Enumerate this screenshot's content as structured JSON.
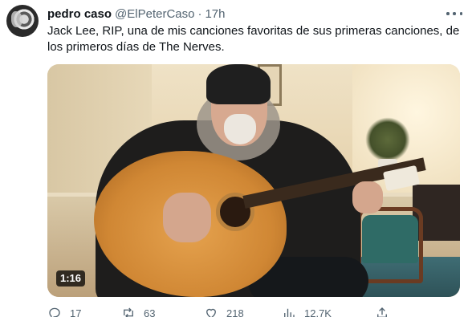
{
  "tweet": {
    "author_name": "pedro caso",
    "handle": "@ElPeterCaso",
    "separator": "·",
    "time": "17h",
    "text": "Jack Lee, RIP, una de mis canciones favoritas de sus primeras canciones, de los primeros días de The Nerves."
  },
  "video": {
    "duration": "1:16"
  },
  "actions": {
    "replies": {
      "icon": "reply-icon",
      "count": "17"
    },
    "reposts": {
      "icon": "repost-icon",
      "count": "63"
    },
    "likes": {
      "icon": "like-icon",
      "count": "218"
    },
    "views": {
      "icon": "views-icon",
      "count": "12.7K"
    },
    "share": {
      "icon": "share-icon"
    }
  },
  "more_menu_icon": "more-icon"
}
